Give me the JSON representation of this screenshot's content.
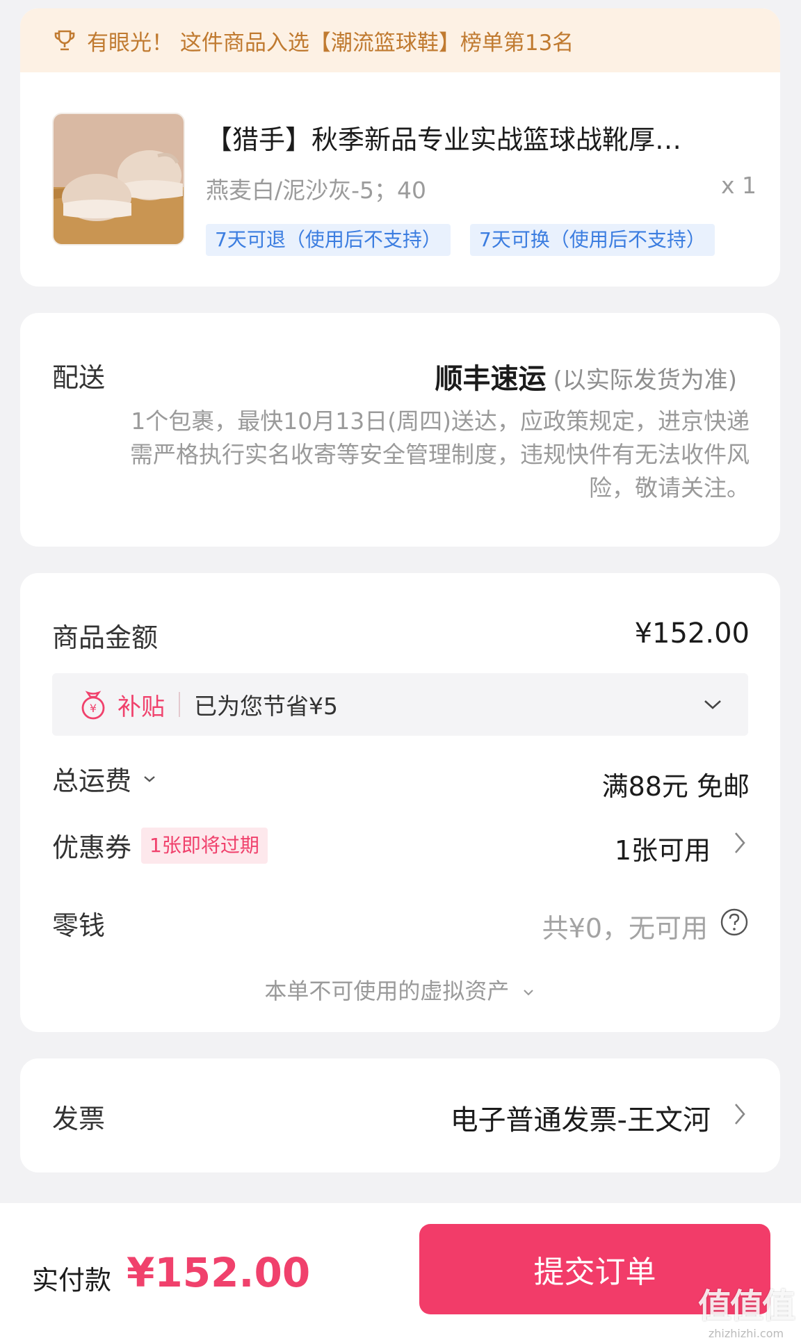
{
  "product_card": {
    "banner_text": "有眼光！ 这件商品入选【潮流篮球鞋】榜单第13名",
    "title": "【猎手】秋季新品专业实战篮球战靴厚…",
    "sku": "燕麦白/泥沙灰-5；40",
    "quantity": "x 1",
    "tags": [
      "7天可退（使用后不支持）",
      "7天可换（使用后不支持）"
    ]
  },
  "delivery": {
    "label": "配送",
    "method": "顺丰速运",
    "method_note": "(以实际发货为准)",
    "description": "1个包裹，最快10月13日(周四)送达，应政策规定，进京快递需严格执行实名收寄等安全管理制度，违规快件有无法收件风险，敬请关注。"
  },
  "pricing": {
    "goods_label": "商品金额",
    "goods_amount": "¥152.00",
    "subsidy_label": "补贴",
    "subsidy_text": "已为您节省¥5",
    "shipping_label": "总运费",
    "shipping_value": "满88元 免邮",
    "coupon_label": "优惠券",
    "coupon_badge": "1张即将过期",
    "coupon_value": "1张可用",
    "change_label": "零钱",
    "change_value": "共¥0，无可用",
    "virtual_assets_text": "本单不可使用的虚拟资产"
  },
  "invoice": {
    "label": "发票",
    "value": "电子普通发票-王文河"
  },
  "footer": {
    "pay_label": "实付款",
    "pay_amount": "¥152.00",
    "submit_label": "提交订单"
  },
  "watermark": {
    "big": "值值值",
    "small": "zhizhizhi.com"
  },
  "colors": {
    "accent": "#f23c69",
    "banner_bg": "#fdf1e4",
    "banner_text": "#c07a30",
    "tag_bg": "#e9f1fd",
    "tag_text": "#3b7de0"
  }
}
